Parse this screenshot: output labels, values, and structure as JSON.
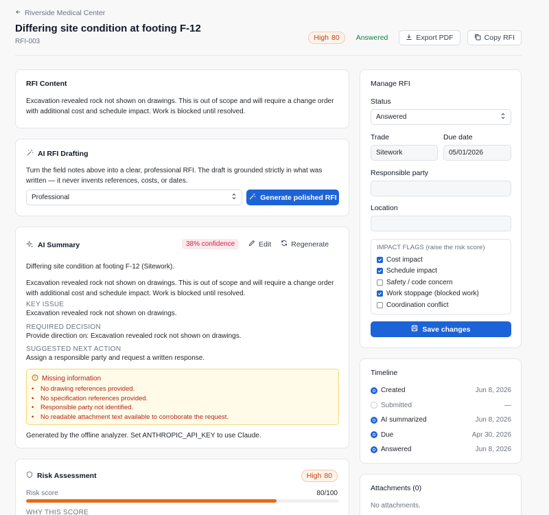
{
  "breadcrumb": {
    "parent": "Riverside Medical Center"
  },
  "header": {
    "title": "Differing site condition at footing F-12",
    "rfi_id": "RFI-003",
    "risk_label": "High",
    "risk_score": "80",
    "status": "Answered",
    "export_label": "Export PDF",
    "copy_label": "Copy RFI"
  },
  "content_card": {
    "title": "RFI Content",
    "text": "Excavation revealed rock not shown on drawings. This is out of scope and will require a change order with additional cost and schedule impact. Work is blocked until resolved."
  },
  "drafting_card": {
    "title": "AI RFI Drafting",
    "description": "Turn the field notes above into a clear, professional RFI. The draft is grounded strictly in what was written — it never invents references, costs, or dates.",
    "tone_selected": "Professional",
    "generate_label": "Generate polished RFI"
  },
  "summary_card": {
    "title": "AI Summary",
    "confidence": "38% confidence",
    "edit_label": "Edit",
    "regenerate_label": "Regenerate",
    "headline": "Differing site condition at footing F-12 (Sitework).",
    "original_text": "Excavation revealed rock not shown on drawings. This is out of scope and will require a change order with additional cost and schedule impact. Work is blocked until resolved.",
    "key_issue_h": "KEY ISSUE",
    "key_issue": "Excavation revealed rock not shown on drawings.",
    "required_decision_h": "REQUIRED DECISION",
    "required_decision": "Provide direction on: Excavation revealed rock not shown on drawings.",
    "next_action_h": "SUGGESTED NEXT ACTION",
    "next_action": "Assign a responsible party and request a written response.",
    "missing_title": "Missing information",
    "missing_items": [
      "No drawing references provided.",
      "No specification references provided.",
      "Responsible party not identified.",
      "No readable attachment text available to corroborate the request."
    ],
    "footer": "Generated by the offline analyzer. Set ANTHROPIC_API_KEY to use Claude."
  },
  "risk_card": {
    "title": "Risk Assessment",
    "badge_label": "High",
    "badge_score": "80",
    "score_label": "Risk score",
    "score_text": "80/100",
    "score_value": 80,
    "why_h": "WHY THIS SCORE"
  },
  "manage": {
    "title": "Manage RFI",
    "status_label": "Status",
    "status_value": "Answered",
    "trade_label": "Trade",
    "trade_value": "Sitework",
    "due_label": "Due date",
    "due_value": "05/01/2026",
    "responsible_label": "Responsible party",
    "responsible_value": "",
    "location_label": "Location",
    "location_value": "",
    "flags_title": "IMPACT FLAGS (raise the risk score)",
    "flags": [
      {
        "label": "Cost impact",
        "checked": true
      },
      {
        "label": "Schedule impact",
        "checked": true
      },
      {
        "label": "Safety / code concern",
        "checked": false
      },
      {
        "label": "Work stoppage (blocked work)",
        "checked": true
      },
      {
        "label": "Coordination conflict",
        "checked": false
      }
    ],
    "save_label": "Save changes"
  },
  "timeline": {
    "title": "Timeline",
    "events": [
      {
        "label": "Created",
        "date": "Jun 8, 2026",
        "done": true
      },
      {
        "label": "Submitted",
        "date": "—",
        "done": false
      },
      {
        "label": "AI summarized",
        "date": "Jun 8, 2026",
        "done": true
      },
      {
        "label": "Due",
        "date": "Apr 30, 2026",
        "done": true
      },
      {
        "label": "Answered",
        "date": "Jun 8, 2026",
        "done": true
      }
    ]
  },
  "attachments": {
    "title": "Attachments (0)",
    "empty": "No attachments."
  },
  "colors": {
    "accent": "#1d63d8",
    "risk": "#ea6a16",
    "success": "#15803d",
    "danger": "#b42318"
  }
}
